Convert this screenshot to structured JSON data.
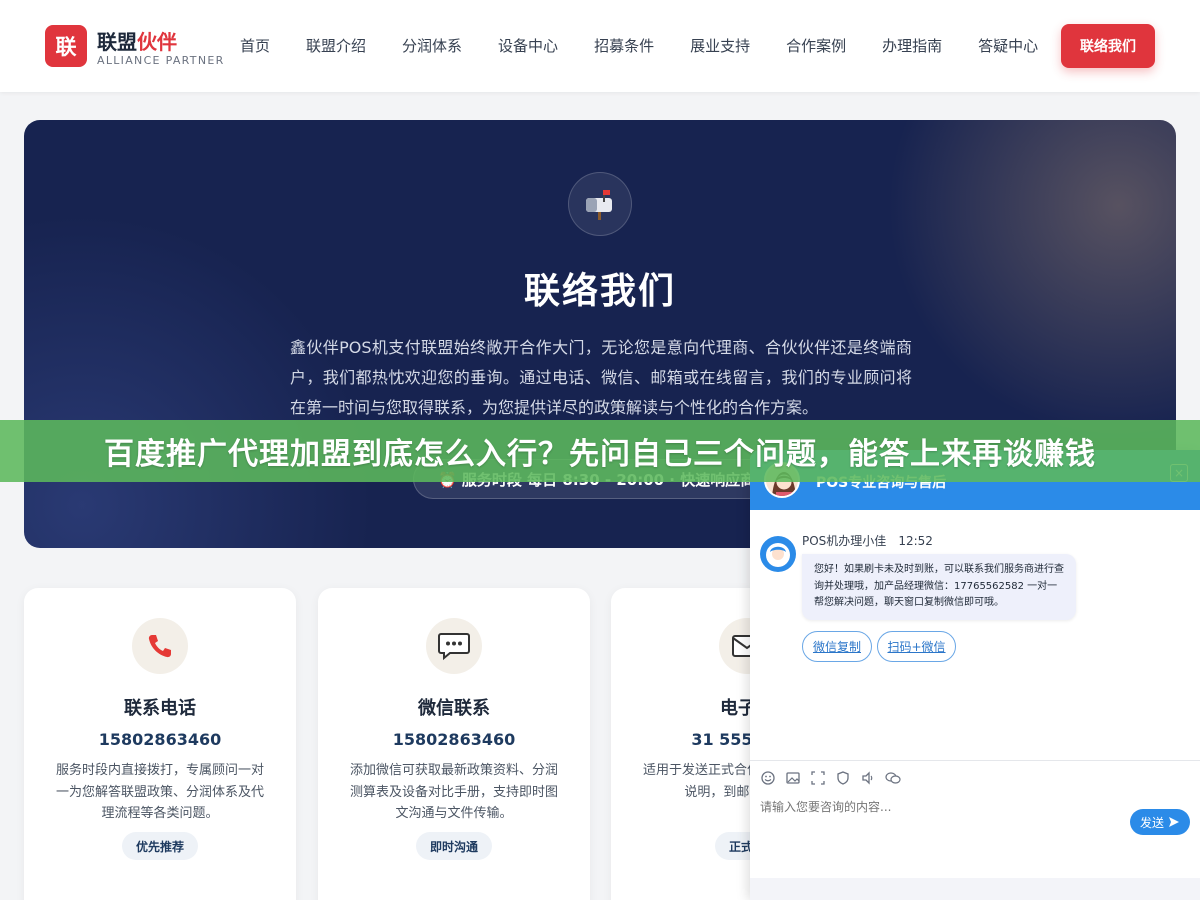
{
  "header": {
    "logo_mark": "联",
    "logo_title_main": "联盟",
    "logo_title_accent": "伙伴",
    "logo_subtitle": "ALLIANCE PARTNER",
    "nav": [
      "首页",
      "联盟介绍",
      "分润体系",
      "设备中心",
      "招募条件",
      "展业支持",
      "合作案例",
      "办理指南",
      "答疑中心"
    ],
    "cta_label": "联络我们"
  },
  "hero": {
    "icon": "mailbox-icon",
    "title": "联络我们",
    "description": "鑫伙伴POS机支付联盟始终敞开合作大门，无论您是意向代理商、合伙伙伴还是终端商户，我们都热忱欢迎您的垂询。通过电话、微信、邮箱或在线留言，我们的专业顾问将在第一时间与您取得联系，为您提供详尽的政策解读与个性化的合作方案。",
    "hours": "⏰ 服务时段 每日 8:30 - 20:00 · 快速响应商"
  },
  "cards": [
    {
      "icon": "phone-icon",
      "title": "联系电话",
      "value": "15802863460",
      "desc": "服务时段内直接拨打，专属顾问一对一为您解答联盟政策、分润体系及代理流程等各类问题。",
      "tag": "优先推荐"
    },
    {
      "icon": "chat-bubble-icon",
      "title": "微信联系",
      "value": "15802863460",
      "desc": "添加微信可获取最新政策资料、分润测算表及设备对比手册，支持即时图文沟通与文件传输。",
      "tag": "即时沟通"
    },
    {
      "icon": "envelope-icon",
      "title": "电子邮",
      "value": "31 555555 3",
      "desc": "适用于发送正式合作文件或详细需求说明，到邮件后4小时",
      "tag": "正式沟"
    }
  ],
  "banner": {
    "text": "百度推广代理加盟到底怎么入行？先问自己三个问题，能答上来再谈赚钱"
  },
  "chat": {
    "header_title": "POS专业咨询与售后",
    "close_label": "×",
    "agent_name": "POS机办理小佳",
    "agent_time": "12:52",
    "message": "您好！如果刷卡未及时到账，可以联系我们服务商进行查询并处理哦，加产品经理微信：17765562582 一对一帮您解决问题，聊天窗口复制微信即可哦。",
    "buttons": [
      "微信复制",
      "扫码+微信"
    ],
    "toolbar": [
      "emoji-icon",
      "image-icon",
      "screenshot-icon",
      "shield-icon",
      "audio-icon",
      "wechat-icon"
    ],
    "input_placeholder": "请输入您要咨询的内容...",
    "send_label": "发送"
  },
  "colors": {
    "brand_red": "#e0353d",
    "hero_navy": "#172350",
    "chat_blue": "#2b8be8",
    "banner_green": "#5cb85c"
  }
}
